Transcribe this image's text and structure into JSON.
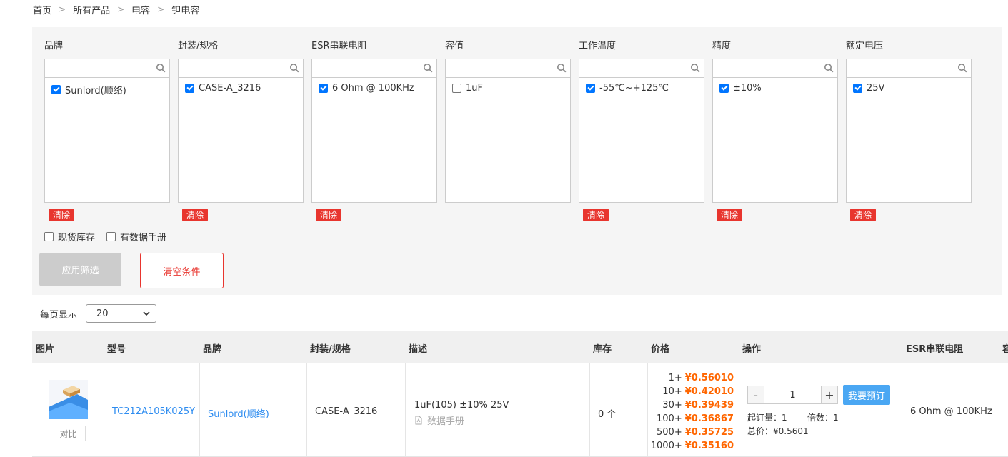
{
  "breadcrumb": [
    "首页",
    "所有产品",
    "电容",
    "钽电容"
  ],
  "filters": [
    {
      "title": "品牌",
      "item": "Sunlord(顺络)",
      "checked": true,
      "clear": "清除"
    },
    {
      "title": "封装/规格",
      "item": "CASE-A_3216",
      "checked": true,
      "clear": "清除"
    },
    {
      "title": "ESR串联电阻",
      "item": "6 Ohm @ 100KHz",
      "checked": true,
      "clear": "清除"
    },
    {
      "title": "容值",
      "item": "1uF",
      "checked": false,
      "clear": ""
    },
    {
      "title": "工作温度",
      "item": "-55℃~+125℃",
      "checked": true,
      "clear": "清除"
    },
    {
      "title": "精度",
      "item": "±10%",
      "checked": true,
      "clear": "清除"
    },
    {
      "title": "额定电压",
      "item": "25V",
      "checked": true,
      "clear": "清除"
    }
  ],
  "options": {
    "in_stock": "现货库存",
    "has_datasheet": "有数据手册"
  },
  "buttons": {
    "apply": "应用筛选",
    "reset": "清空条件"
  },
  "perpage": {
    "label": "每页显示",
    "value": "20"
  },
  "table": {
    "headers": [
      "图片",
      "型号",
      "品牌",
      "封装/规格",
      "描述",
      "库存",
      "价格",
      "操作",
      "ESR串联电阻",
      "容"
    ],
    "row": {
      "compare": "对比",
      "model": "TC212A105K025Y",
      "brand": "Sunlord(顺络)",
      "package": "CASE-A_3216",
      "desc": "1uF(105) ±10% 25V",
      "datasheet": "数据手册",
      "stock": "0 个",
      "prices": [
        {
          "qty": "1+",
          "price": "¥0.56010"
        },
        {
          "qty": "10+",
          "price": "¥0.42010"
        },
        {
          "qty": "30+",
          "price": "¥0.39439"
        },
        {
          "qty": "100+",
          "price": "¥0.36867"
        },
        {
          "qty": "500+",
          "price": "¥0.35725"
        },
        {
          "qty": "1000+",
          "price": "¥0.35160"
        }
      ],
      "qty_minus": "-",
      "qty_value": "1",
      "qty_plus": "+",
      "order": "我要预订",
      "min_order": "起订量：1",
      "multiple": "倍数：1",
      "total": "总价：¥0.5601",
      "esr": "6 Ohm @ 100KHz"
    }
  },
  "colors": {
    "accent_red": "#e8352e",
    "price_orange": "#ff6600",
    "link_blue": "#2d8cf0",
    "order_blue": "#4aa7f3"
  }
}
